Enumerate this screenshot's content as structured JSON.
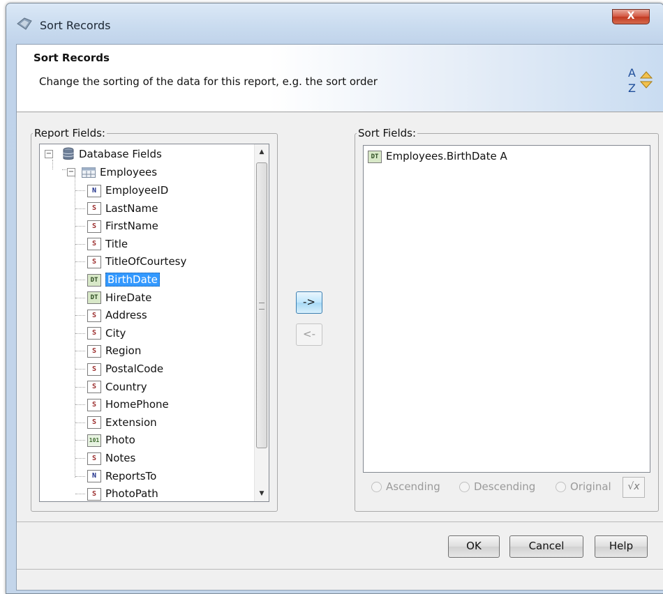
{
  "window": {
    "title": "Sort Records",
    "close_label": "X"
  },
  "header": {
    "title": "Sort Records",
    "description": "Change the sorting of the data for this report, e.g. the sort order",
    "icon": "sort-az-icon",
    "icon_letters": [
      "A",
      "Z"
    ]
  },
  "report_fields": {
    "legend": "Report Fields:",
    "root": {
      "label": "Database Fields",
      "icon": "database-icon",
      "expander": "−"
    },
    "table": {
      "label": "Employees",
      "icon": "table-icon",
      "expander": "−"
    },
    "fields": [
      {
        "label": "EmployeeID",
        "type": "N"
      },
      {
        "label": "LastName",
        "type": "S"
      },
      {
        "label": "FirstName",
        "type": "S"
      },
      {
        "label": "Title",
        "type": "S"
      },
      {
        "label": "TitleOfCourtesy",
        "type": "S"
      },
      {
        "label": "BirthDate",
        "type": "DT",
        "selected": true
      },
      {
        "label": "HireDate",
        "type": "DT"
      },
      {
        "label": "Address",
        "type": "S"
      },
      {
        "label": "City",
        "type": "S"
      },
      {
        "label": "Region",
        "type": "S"
      },
      {
        "label": "PostalCode",
        "type": "S"
      },
      {
        "label": "Country",
        "type": "S"
      },
      {
        "label": "HomePhone",
        "type": "S"
      },
      {
        "label": "Extension",
        "type": "S"
      },
      {
        "label": "Photo",
        "type": "101"
      },
      {
        "label": "Notes",
        "type": "S"
      },
      {
        "label": "ReportsTo",
        "type": "N"
      },
      {
        "label": "PhotoPath",
        "type": "S"
      }
    ],
    "scroll_up": "▲",
    "scroll_down": "▼"
  },
  "move_buttons": {
    "add": "->",
    "remove": "<-"
  },
  "sort_fields": {
    "legend": "Sort Fields:",
    "items": [
      {
        "label": "Employees.BirthDate A",
        "type": "DT"
      }
    ],
    "options": [
      "Ascending",
      "Descending",
      "Original"
    ],
    "formula_label": "√x"
  },
  "footer": {
    "ok": "OK",
    "cancel": "Cancel",
    "help": "Help"
  },
  "colors": {
    "selection": "#3399ff",
    "titlebar": "#c9dbef",
    "close": "#c23a22"
  }
}
